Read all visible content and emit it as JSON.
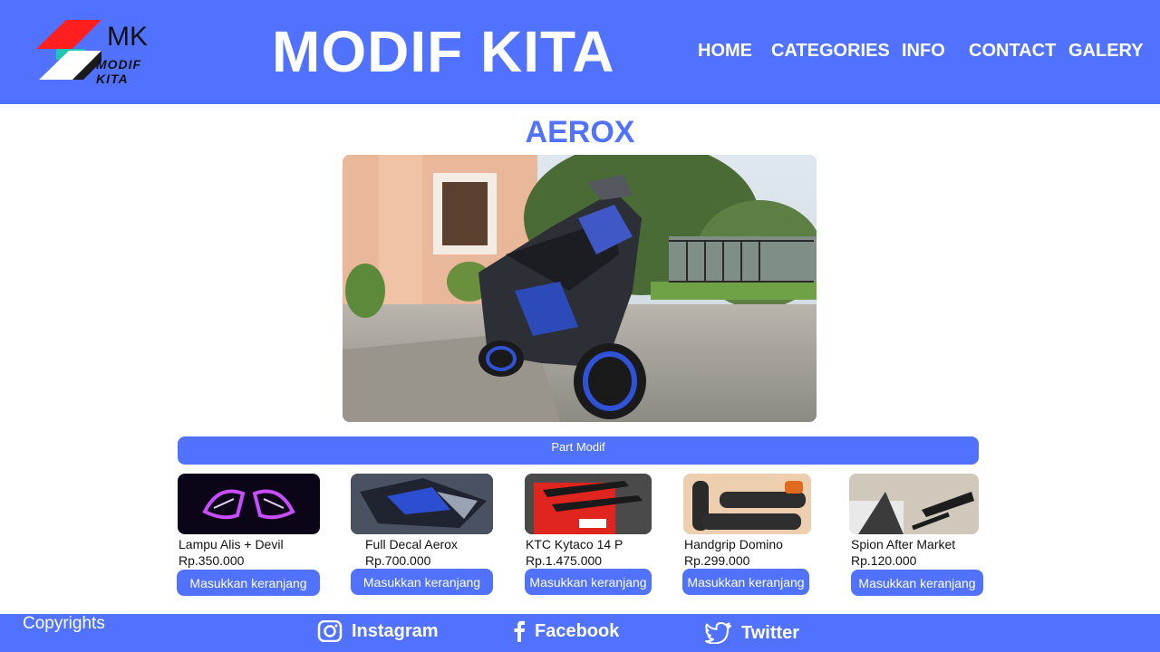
{
  "brand": {
    "logo_text": "MK",
    "logo_subtext": "MODIF KITA",
    "site_title": "MODIF KITA"
  },
  "nav": {
    "items": [
      {
        "label": "HOME"
      },
      {
        "label": "CATEGORIES"
      },
      {
        "label": "INFO"
      },
      {
        "label": "CONTACT"
      },
      {
        "label": "GALERY"
      }
    ]
  },
  "main": {
    "heading": "AEROX",
    "section_label": "Part Modif",
    "products": [
      {
        "name": "Lampu Alis + Devil",
        "price": "Rp.350.000",
        "button": "Masukkan keranjang"
      },
      {
        "name": "Full Decal Aerox",
        "price": "Rp.700.000",
        "button": "Masukkan keranjang"
      },
      {
        "name": "KTC Kytaco 14 P",
        "price": "Rp.1.475.000",
        "button": "Masukkan keranjang"
      },
      {
        "name": "Handgrip Domino",
        "price": "Rp.299.000",
        "button": "Masukkan keranjang"
      },
      {
        "name": "Spion After Market",
        "price": "Rp.120.000",
        "button": "Masukkan keranjang"
      }
    ]
  },
  "footer": {
    "copyright": "Copyrights",
    "social": [
      {
        "label": "Instagram",
        "icon": "instagram-icon"
      },
      {
        "label": "Facebook",
        "icon": "facebook-icon"
      },
      {
        "label": "Twitter",
        "icon": "twitter-icon"
      }
    ]
  },
  "colors": {
    "primary": "#5072ff",
    "logo_red": "#ff1f1f",
    "text_dark": "#111111"
  }
}
